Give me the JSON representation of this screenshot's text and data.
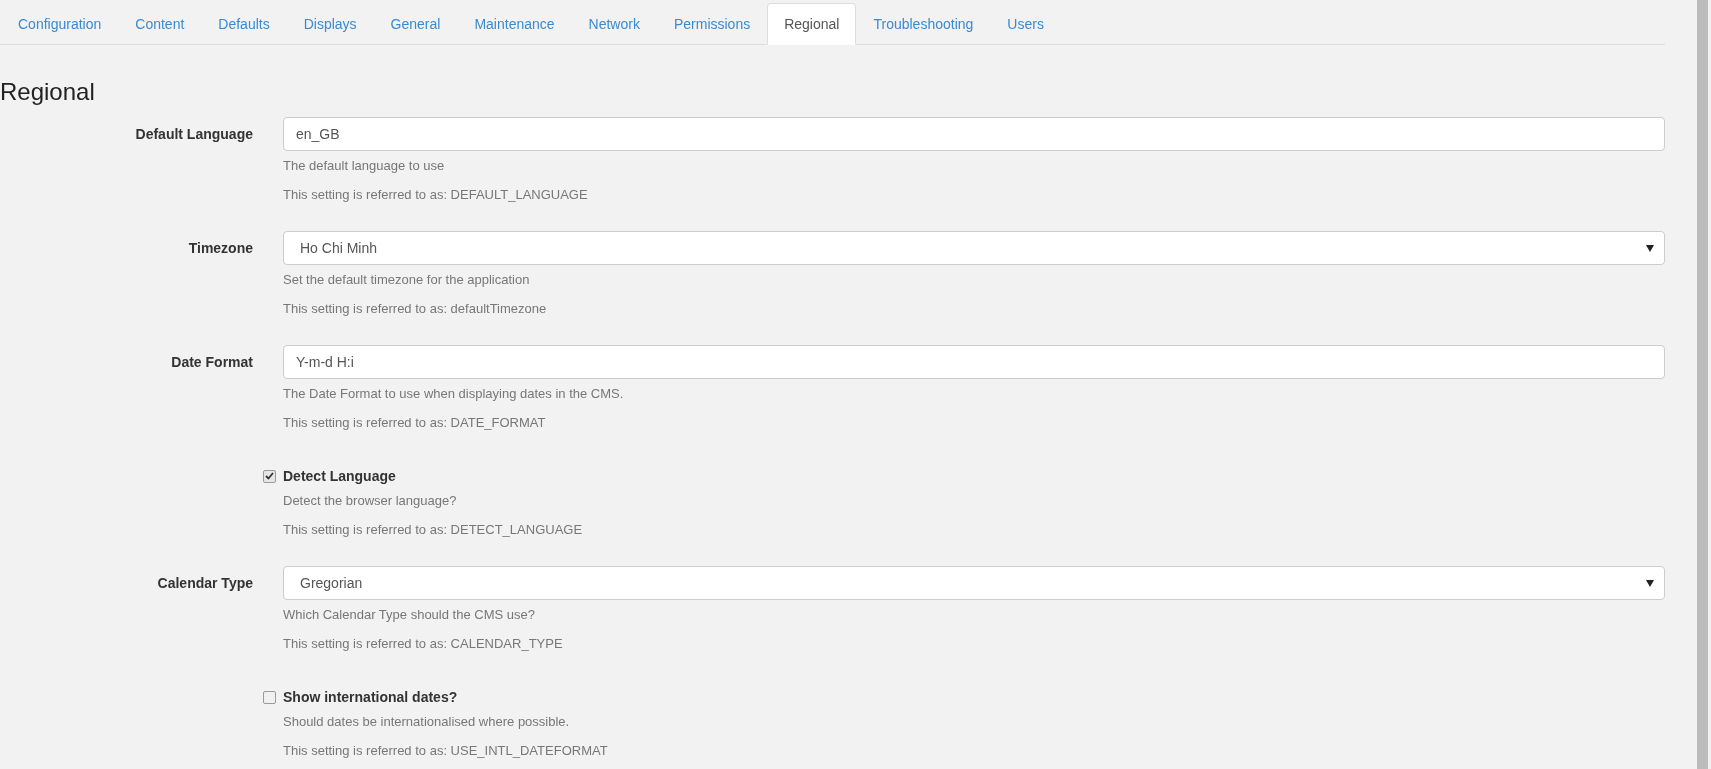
{
  "tabs": [
    {
      "label": "Configuration",
      "selected": false
    },
    {
      "label": "Content",
      "selected": false
    },
    {
      "label": "Defaults",
      "selected": false
    },
    {
      "label": "Displays",
      "selected": false
    },
    {
      "label": "General",
      "selected": false
    },
    {
      "label": "Maintenance",
      "selected": false
    },
    {
      "label": "Network",
      "selected": false
    },
    {
      "label": "Permissions",
      "selected": false
    },
    {
      "label": "Regional",
      "selected": true
    },
    {
      "label": "Troubleshooting",
      "selected": false
    },
    {
      "label": "Users",
      "selected": false
    }
  ],
  "heading": "Regional",
  "settings": [
    {
      "kind": "text",
      "label": "Default Language",
      "value": "en_GB",
      "help": "The default language to use",
      "reference": "This setting is referred to as: DEFAULT_LANGUAGE"
    },
    {
      "kind": "select",
      "label": "Timezone",
      "value": "Ho Chi Minh",
      "help": "Set the default timezone for the application",
      "reference": "This setting is referred to as: defaultTimezone"
    },
    {
      "kind": "text",
      "label": "Date Format",
      "value": "Y-m-d H:i",
      "help": "The Date Format to use when displaying dates in the CMS.",
      "reference": "This setting is referred to as: DATE_FORMAT"
    },
    {
      "kind": "checkbox",
      "label": "Detect Language",
      "checked": true,
      "help": "Detect the browser language?",
      "reference": "This setting is referred to as: DETECT_LANGUAGE"
    },
    {
      "kind": "select",
      "label": "Calendar Type",
      "value": "Gregorian",
      "help": "Which Calendar Type should the CMS use?",
      "reference": "This setting is referred to as: CALENDAR_TYPE"
    },
    {
      "kind": "checkbox",
      "label": "Show international dates?",
      "checked": false,
      "help": "Should dates be internationalised where possible.",
      "reference": "This setting is referred to as: USE_INTL_DATEFORMAT"
    }
  ]
}
